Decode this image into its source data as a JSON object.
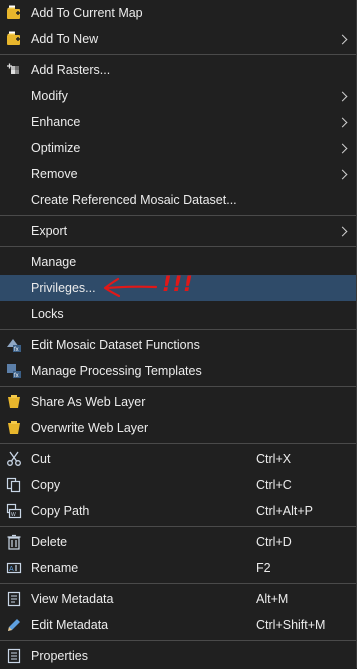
{
  "menu": {
    "items": [
      {
        "id": "add-to-current-map",
        "icon": "layers-add-icon",
        "label": "Add To Current Map",
        "shortcut": "",
        "submenu": false
      },
      {
        "id": "add-to-new",
        "icon": "layers-new-icon",
        "label": "Add To New",
        "shortcut": "",
        "submenu": true
      },
      {
        "id": "add-rasters",
        "icon": "add-rasters-icon",
        "label": "Add Rasters...",
        "shortcut": "",
        "submenu": false
      },
      {
        "id": "modify",
        "icon": "",
        "label": "Modify",
        "shortcut": "",
        "submenu": true
      },
      {
        "id": "enhance",
        "icon": "",
        "label": "Enhance",
        "shortcut": "",
        "submenu": true
      },
      {
        "id": "optimize",
        "icon": "",
        "label": "Optimize",
        "shortcut": "",
        "submenu": true
      },
      {
        "id": "remove",
        "icon": "",
        "label": "Remove",
        "shortcut": "",
        "submenu": true
      },
      {
        "id": "create-referenced",
        "icon": "",
        "label": "Create Referenced Mosaic Dataset...",
        "shortcut": "",
        "submenu": false
      },
      {
        "id": "export",
        "icon": "",
        "label": "Export",
        "shortcut": "",
        "submenu": true
      },
      {
        "id": "manage",
        "icon": "",
        "label": "Manage",
        "shortcut": "",
        "submenu": false
      },
      {
        "id": "privileges",
        "icon": "",
        "label": "Privileges...",
        "shortcut": "",
        "submenu": false
      },
      {
        "id": "locks",
        "icon": "",
        "label": "Locks",
        "shortcut": "",
        "submenu": false
      },
      {
        "id": "edit-functions",
        "icon": "mosaic-functions-icon",
        "label": "Edit Mosaic Dataset Functions",
        "shortcut": "",
        "submenu": false
      },
      {
        "id": "manage-templates",
        "icon": "processing-templates-icon",
        "label": "Manage Processing Templates",
        "shortcut": "",
        "submenu": false
      },
      {
        "id": "share-web-layer",
        "icon": "share-web-layer-icon",
        "label": "Share As Web Layer",
        "shortcut": "",
        "submenu": false
      },
      {
        "id": "overwrite-web-layer",
        "icon": "overwrite-web-layer-icon",
        "label": "Overwrite Web Layer",
        "shortcut": "",
        "submenu": false
      },
      {
        "id": "cut",
        "icon": "scissors-icon",
        "label": "Cut",
        "shortcut": "Ctrl+X",
        "submenu": false
      },
      {
        "id": "copy",
        "icon": "copy-icon",
        "label": "Copy",
        "shortcut": "Ctrl+C",
        "submenu": false
      },
      {
        "id": "copy-path",
        "icon": "copy-path-icon",
        "label": "Copy Path",
        "shortcut": "Ctrl+Alt+P",
        "submenu": false
      },
      {
        "id": "delete",
        "icon": "trash-icon",
        "label": "Delete",
        "shortcut": "Ctrl+D",
        "submenu": false
      },
      {
        "id": "rename",
        "icon": "rename-icon",
        "label": "Rename",
        "shortcut": "F2",
        "submenu": false
      },
      {
        "id": "view-metadata",
        "icon": "view-metadata-icon",
        "label": "View Metadata",
        "shortcut": "Alt+M",
        "submenu": false
      },
      {
        "id": "edit-metadata",
        "icon": "pencil-icon",
        "label": "Edit Metadata",
        "shortcut": "Ctrl+Shift+M",
        "submenu": false
      },
      {
        "id": "properties",
        "icon": "properties-icon",
        "label": "Properties",
        "shortcut": "",
        "submenu": false
      }
    ],
    "highlighted": "privileges"
  },
  "annotation": {
    "text": "!!!",
    "color": "#e01818",
    "icon": "hand-drawn-arrow-icon"
  },
  "colors": {
    "background": "#202020",
    "highlight": "#2f4b69",
    "text": "#ececec",
    "separator": "#4a4a4a",
    "folder_yellow": "#e8b62c"
  }
}
